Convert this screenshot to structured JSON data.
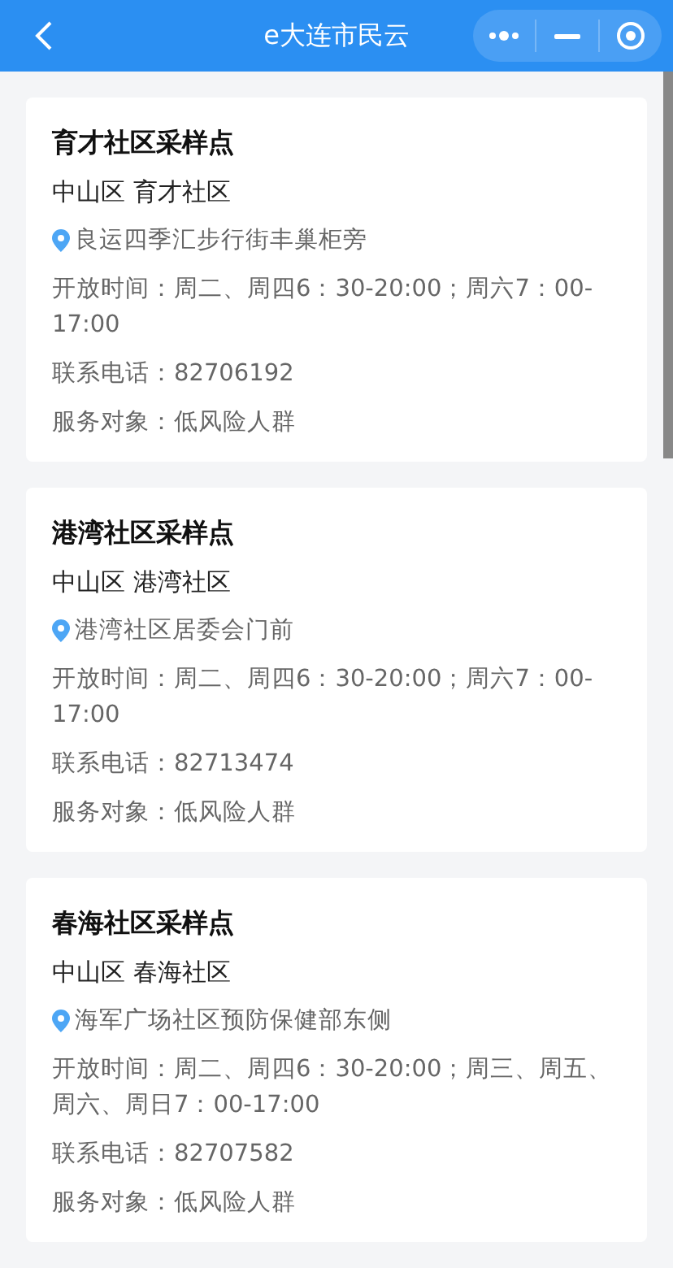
{
  "header": {
    "title": "e大连市民云"
  },
  "points": [
    {
      "name": "育才社区采样点",
      "district": "中山区 育才社区",
      "address": "良运四季汇步行街丰巢柜旁",
      "hours": "开放时间：周二、周四6：30-20:00；周六7：00-17:00",
      "phone": "联系电话：82706192",
      "target": "服务对象：低风险人群"
    },
    {
      "name": "港湾社区采样点",
      "district": "中山区 港湾社区",
      "address": "港湾社区居委会门前",
      "hours": "开放时间：周二、周四6：30-20:00；周六7：00-17:00",
      "phone": "联系电话：82713474",
      "target": "服务对象：低风险人群"
    },
    {
      "name": "春海社区采样点",
      "district": "中山区 春海社区",
      "address": "海军广场社区预防保健部东侧",
      "hours": "开放时间：周二、周四6：30-20:00；周三、周五、周六、周日7：00-17:00",
      "phone": "联系电话：82707582",
      "target": "服务对象：低风险人群"
    }
  ]
}
